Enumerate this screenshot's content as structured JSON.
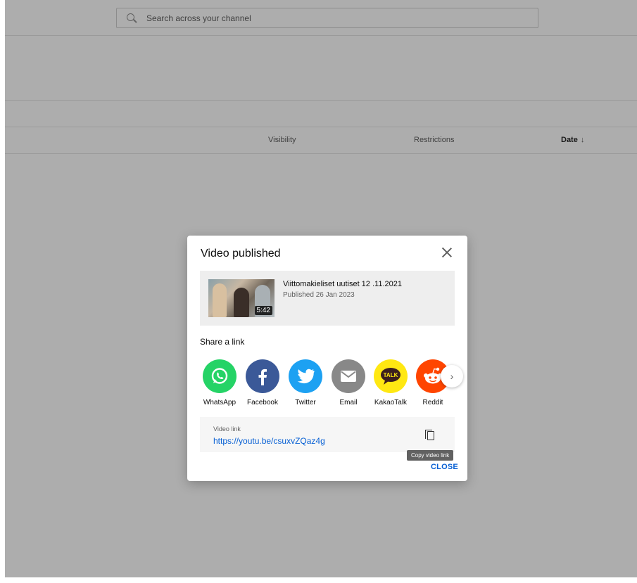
{
  "search": {
    "placeholder": "Search across your channel"
  },
  "table": {
    "columns": [
      "Visibility",
      "Restrictions",
      "Date"
    ],
    "date_sort_icon": "arrow-down-icon"
  },
  "dialog": {
    "title": "Video published",
    "video": {
      "title": "Viittomakieliset uutiset 12 .11.2021",
      "published": "Published 26 Jan 2023",
      "duration": "5:42"
    },
    "share_label": "Share a link",
    "share_targets": [
      {
        "label": "WhatsApp",
        "color": "#25d366",
        "icon": "whatsapp-icon"
      },
      {
        "label": "Facebook",
        "color": "#3b5998",
        "icon": "facebook-icon"
      },
      {
        "label": "Twitter",
        "color": "#1da1f2",
        "icon": "twitter-icon"
      },
      {
        "label": "Email",
        "color": "#888888",
        "icon": "email-icon"
      },
      {
        "label": "KakaoTalk",
        "color": "#ffe812",
        "icon": "kakaotalk-icon"
      },
      {
        "label": "Reddit",
        "color": "#ff4500",
        "icon": "reddit-icon"
      }
    ],
    "link": {
      "label": "Video link",
      "url": "https://youtu.be/csuxvZQaz4g"
    },
    "tooltip": "Copy video link",
    "close_label": "CLOSE"
  }
}
